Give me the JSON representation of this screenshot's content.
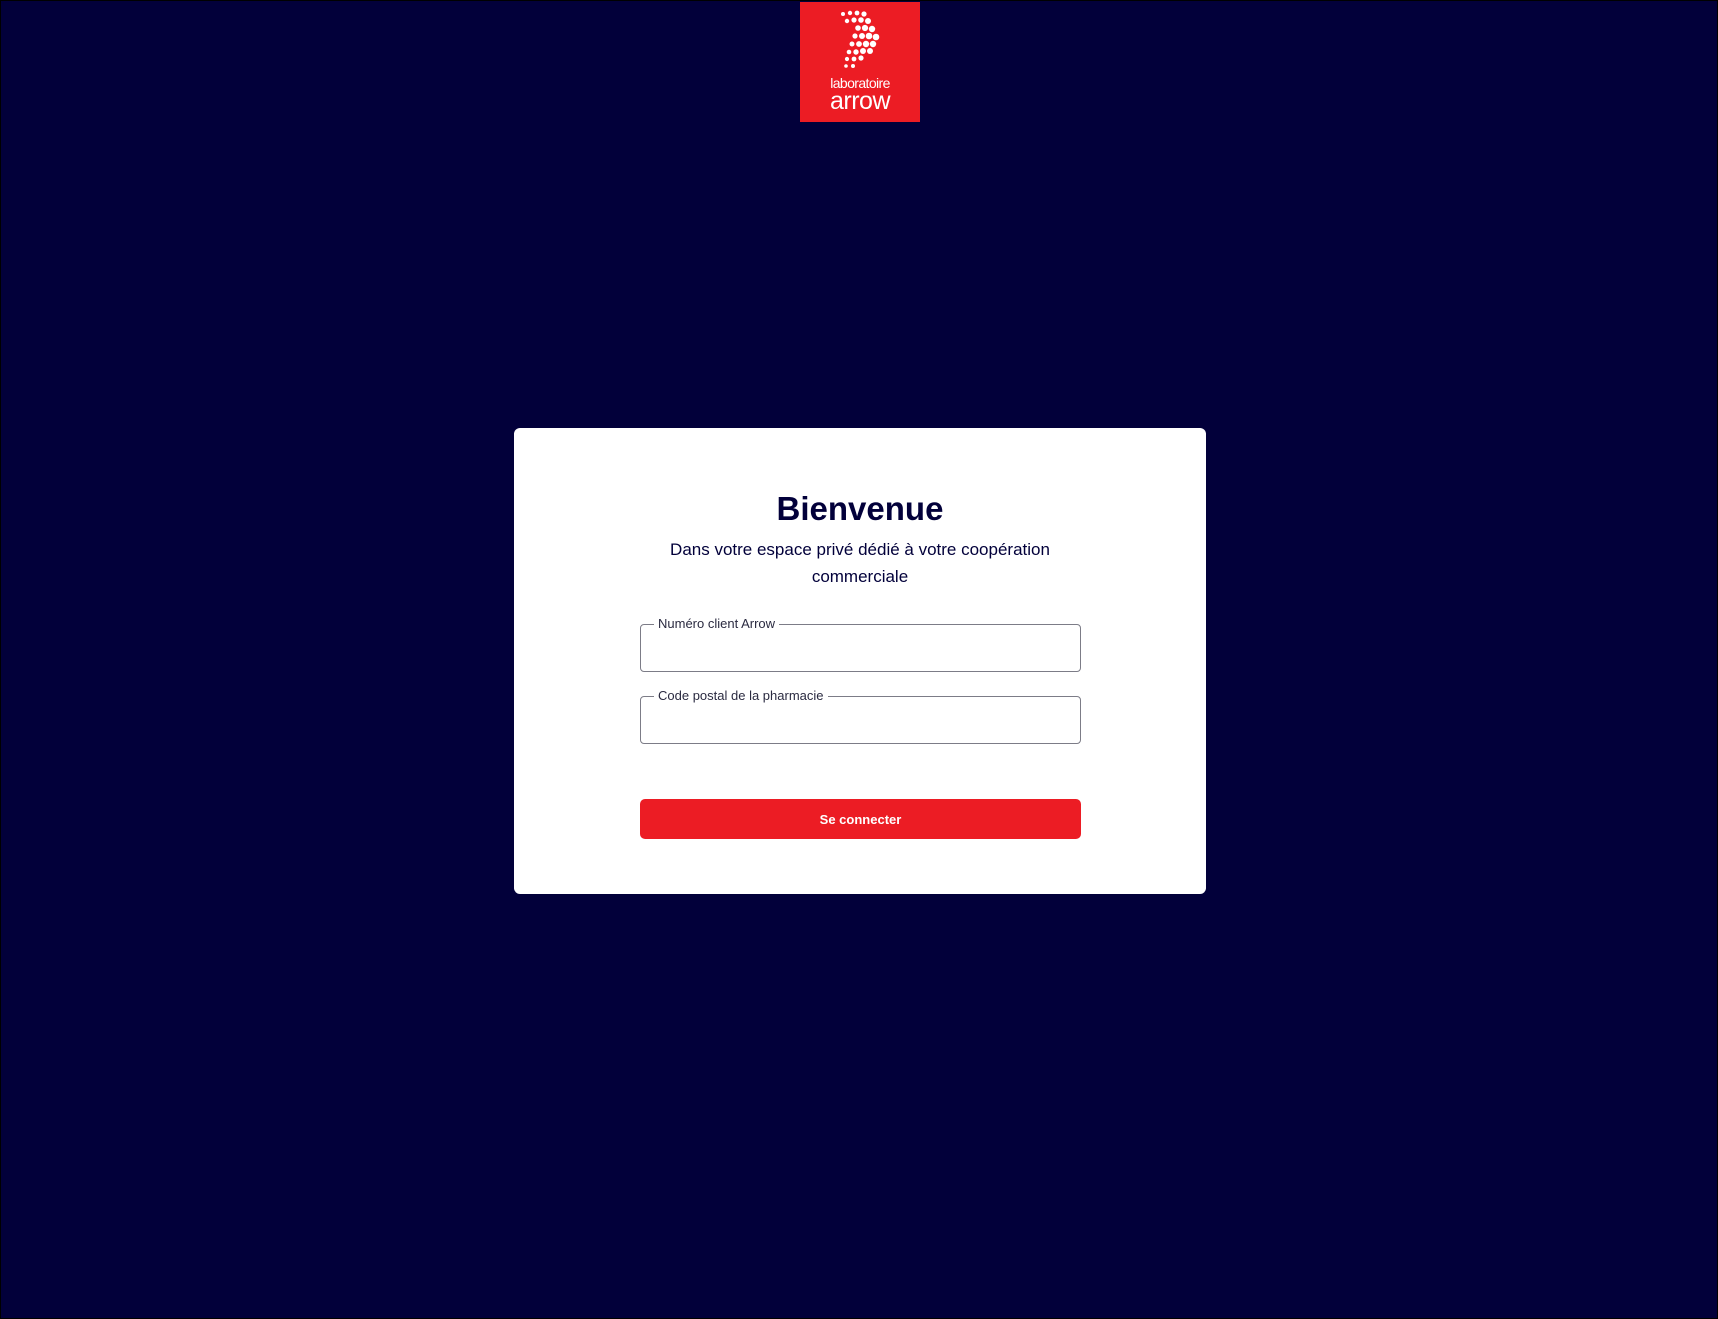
{
  "brand": {
    "logo_line1": "laboratoire",
    "logo_line2": "arrow",
    "color": "#ec1c24",
    "background": "#02003a"
  },
  "login": {
    "title": "Bienvenue",
    "subtitle": "Dans votre espace privé dédié à votre coopération commerciale",
    "client_number": {
      "label": "Numéro client Arrow",
      "value": ""
    },
    "postal_code": {
      "label": "Code postal de la pharmacie",
      "value": ""
    },
    "submit_label": "Se connecter"
  }
}
